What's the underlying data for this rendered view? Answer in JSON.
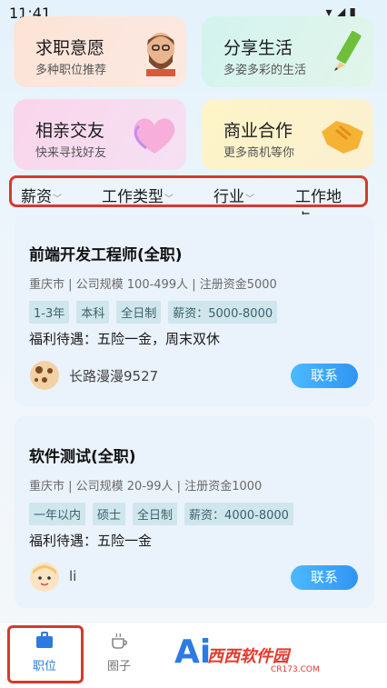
{
  "status": {
    "time": "11:41"
  },
  "cards": [
    {
      "title": "求职意愿",
      "subtitle": "多种职位推荐",
      "icon": "man-avatar-icon"
    },
    {
      "title": "分享生活",
      "subtitle": "多姿多彩的生活",
      "icon": "pencil-icon"
    },
    {
      "title": "相亲交友",
      "subtitle": "快来寻找好友",
      "icon": "heart-icon"
    },
    {
      "title": "商业合作",
      "subtitle": "更多商机等你",
      "icon": "handshake-icon"
    }
  ],
  "filters": [
    "薪资",
    "工作类型",
    "行业",
    "工作地点"
  ],
  "jobs": [
    {
      "title": "前端开发工程师(全职)",
      "meta": "重庆市 | 公司规模 100-499人 | 注册资金5000",
      "tags": [
        "1-3年",
        "本科",
        "全日制",
        "薪资：5000-8000"
      ],
      "benefits": "福利待遇：五险一金，周末双休",
      "user": "长路漫漫9527",
      "action": "联系"
    },
    {
      "title": "软件测试(全职)",
      "meta": "重庆市 | 公司规模 20-99人 | 注册资金1000",
      "tags": [
        "一年以内",
        "硕士",
        "全日制",
        "薪资：4000-8000"
      ],
      "benefits": "福利待遇：五险一金",
      "user": "li",
      "action": "联系"
    }
  ],
  "tabs": [
    {
      "label": "职位",
      "icon": "briefcase-icon"
    },
    {
      "label": "圈子",
      "icon": "coffee-cup-icon"
    }
  ],
  "ai_label": "Ai",
  "watermark": {
    "brand": "西西软件园",
    "url": "CR173.COM"
  },
  "colors": {
    "accent": "#2f95f2",
    "highlight_border": "#d43a2e"
  }
}
